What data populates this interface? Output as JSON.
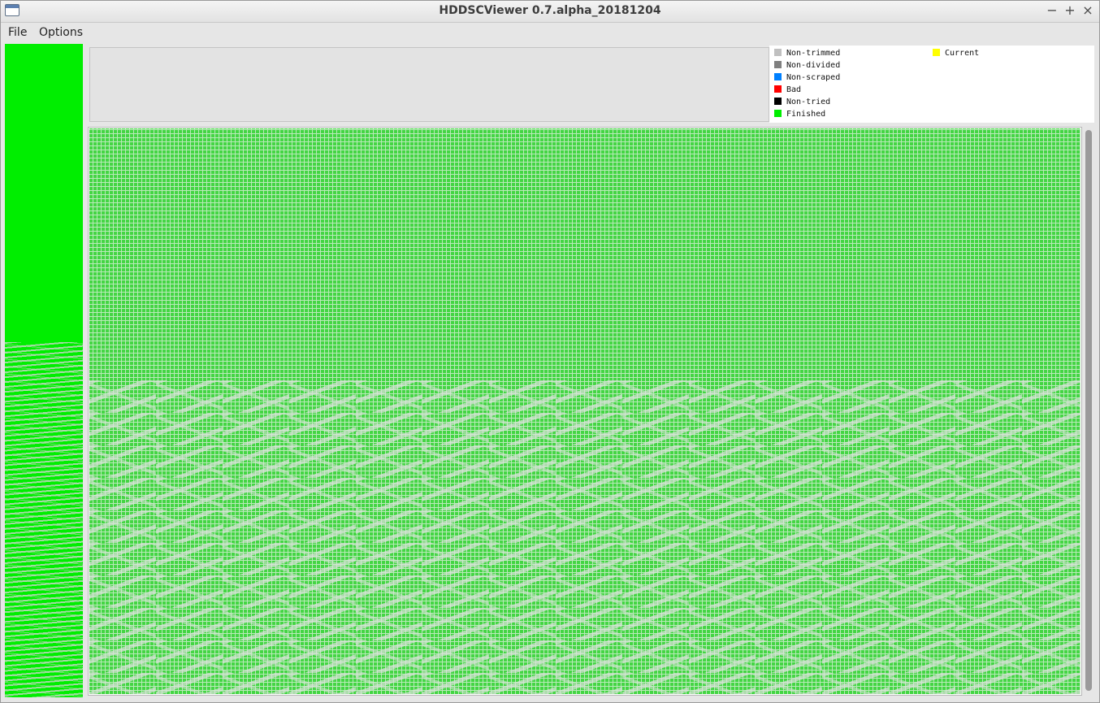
{
  "window": {
    "title": "HDDSCViewer 0.7.alpha_20181204",
    "controls": {
      "minimize": "−",
      "maximize": "+",
      "close": "×"
    }
  },
  "menubar": {
    "items": [
      "File",
      "Options"
    ]
  },
  "legend": {
    "items": [
      {
        "label": "Non-trimmed",
        "color": "#c0c0c0"
      },
      {
        "label": "Non-divided",
        "color": "#808080"
      },
      {
        "label": "Non-scraped",
        "color": "#0080ff"
      },
      {
        "label": "Bad",
        "color": "#ff0000"
      },
      {
        "label": "Non-tried",
        "color": "#000000"
      },
      {
        "label": "Finished",
        "color": "#00ee00"
      },
      {
        "label": "Current",
        "color": "#ffff00"
      }
    ]
  },
  "colors": {
    "finished_overview": "#00ee00",
    "finished_block": "#44d544",
    "non_trimmed_block": "#e1e1e1"
  },
  "icons": {
    "app": "window-icon",
    "scrollbar": "vertical-scrollbar"
  }
}
